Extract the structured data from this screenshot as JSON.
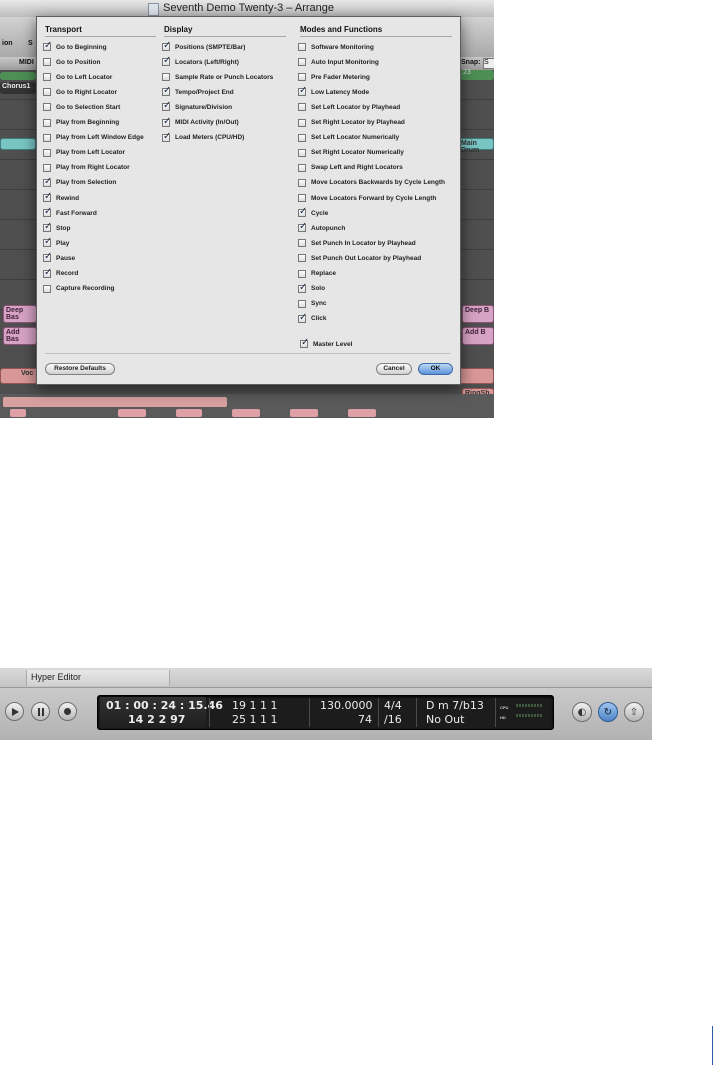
{
  "arrange_window": {
    "title": "Seventh Demo Twenty-3 – Arrange",
    "toolbar_labels": [
      "ion",
      "S"
    ],
    "arrange_bar": {
      "midi_label": "MIDI",
      "snap_label": "Snap:",
      "snap_value": "S"
    },
    "ruler_number": "23",
    "regions": {
      "chorus": "Chorus1",
      "drum_right": "Main Drum",
      "deep_left": "Deep Bas",
      "deep_right": "Deep B",
      "add_left": "Add Bas",
      "add_right": "Add B",
      "vocal": "Voc",
      "ring": "RingSh"
    }
  },
  "dialog": {
    "transport": {
      "heading": "Transport",
      "items": [
        {
          "label": "Go to Beginning",
          "checked": true
        },
        {
          "label": "Go to Position",
          "checked": false
        },
        {
          "label": "Go to Left Locator",
          "checked": false
        },
        {
          "label": "Go to Right Locator",
          "checked": false
        },
        {
          "label": "Go to Selection Start",
          "checked": false
        },
        {
          "label": "Play from Beginning",
          "checked": false
        },
        {
          "label": "Play from Left Window Edge",
          "checked": false
        },
        {
          "label": "Play from Left Locator",
          "checked": false
        },
        {
          "label": "Play from Right Locator",
          "checked": false
        },
        {
          "label": "Play from Selection",
          "checked": true
        },
        {
          "label": "Rewind",
          "checked": true
        },
        {
          "label": "Fast Forward",
          "checked": true
        },
        {
          "label": "Stop",
          "checked": true
        },
        {
          "label": "Play",
          "checked": true
        },
        {
          "label": "Pause",
          "checked": true
        },
        {
          "label": "Record",
          "checked": true
        },
        {
          "label": "Capture Recording",
          "checked": false
        }
      ]
    },
    "display": {
      "heading": "Display",
      "items": [
        {
          "label": "Positions (SMPTE/Bar)",
          "checked": true
        },
        {
          "label": "Locators (Left/Right)",
          "checked": true
        },
        {
          "label": "Sample Rate or Punch Locators",
          "checked": false
        },
        {
          "label": "Tempo/Project End",
          "checked": true
        },
        {
          "label": "Signature/Division",
          "checked": true
        },
        {
          "label": "MIDI Activity (In/Out)",
          "checked": true
        },
        {
          "label": "Load Meters (CPU/HD)",
          "checked": true
        }
      ]
    },
    "modes": {
      "heading": "Modes and Functions",
      "items": [
        {
          "label": "Software Monitoring",
          "checked": false
        },
        {
          "label": "Auto Input Monitoring",
          "checked": false
        },
        {
          "label": "Pre Fader Metering",
          "checked": false
        },
        {
          "label": "Low Latency Mode",
          "checked": true
        },
        {
          "label": "Set Left Locator by Playhead",
          "checked": false
        },
        {
          "label": "Set Right Locator by Playhead",
          "checked": false
        },
        {
          "label": "Set Left Locator Numerically",
          "checked": false
        },
        {
          "label": "Set Right Locator Numerically",
          "checked": false
        },
        {
          "label": "Swap Left and Right Locators",
          "checked": false
        },
        {
          "label": "Move Locators Backwards by Cycle Length",
          "checked": false
        },
        {
          "label": "Move Locators Forward by Cycle Length",
          "checked": false
        },
        {
          "label": "Cycle",
          "checked": true
        },
        {
          "label": "Autopunch",
          "checked": true
        },
        {
          "label": "Set Punch In Locator by Playhead",
          "checked": false
        },
        {
          "label": "Set Punch Out Locator by Playhead",
          "checked": false
        },
        {
          "label": "Replace",
          "checked": false
        },
        {
          "label": "Solo",
          "checked": true
        },
        {
          "label": "Sync",
          "checked": false
        },
        {
          "label": "Click",
          "checked": true
        }
      ],
      "extra": {
        "label": "Master Level",
        "checked": true
      }
    },
    "buttons": {
      "restore": "Restore Defaults",
      "cancel": "Cancel",
      "ok": "OK"
    }
  },
  "transport_bar": {
    "editor_tab": "Hyper Editor",
    "smpte": "01 : 00 : 24 : 15.46",
    "bar_position": "14   2   2   97",
    "left_locator": "19    1    1    1",
    "right_locator": "25    1    1    1",
    "tempo": "130.0000",
    "project_end": "74",
    "signature": "4/4",
    "division": "/16",
    "midi_in": "D m 7/b13",
    "midi_out": "No Out",
    "cpu_label": "CPU",
    "hd_label": "HD",
    "buttons": [
      "play-icon",
      "pause-icon",
      "record-icon",
      "low-latency-icon",
      "cycle-icon",
      "autopunch-icon"
    ]
  }
}
